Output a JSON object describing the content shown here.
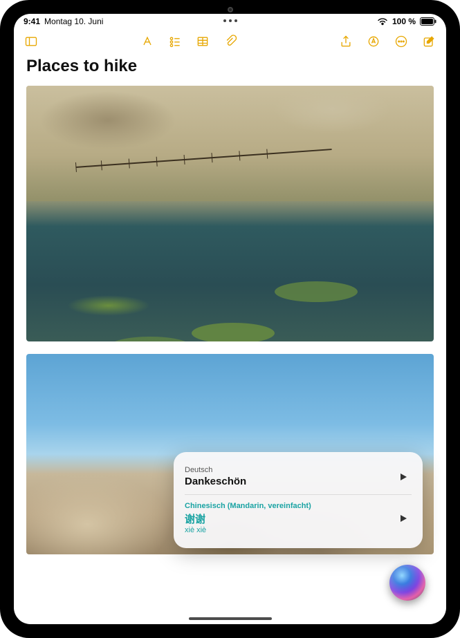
{
  "status": {
    "time": "9:41",
    "date": "Montag 10. Juni",
    "battery_pct": "100 %"
  },
  "toolbar": {
    "icons": {
      "sidebar": "sidebar-icon",
      "format": "text-format-icon",
      "checklist": "checklist-icon",
      "table": "table-icon",
      "attach": "paperclip-icon",
      "share": "share-icon",
      "markup": "markup-icon",
      "more": "more-icon",
      "compose": "compose-icon"
    }
  },
  "note": {
    "title": "Places to hike"
  },
  "siri": {
    "source_lang": "Deutsch",
    "source_text": "Dankeschön",
    "target_lang": "Chinesisch (Mandarin, vereinfacht)",
    "target_text": "谢谢",
    "target_roman": "xiè xiè"
  }
}
